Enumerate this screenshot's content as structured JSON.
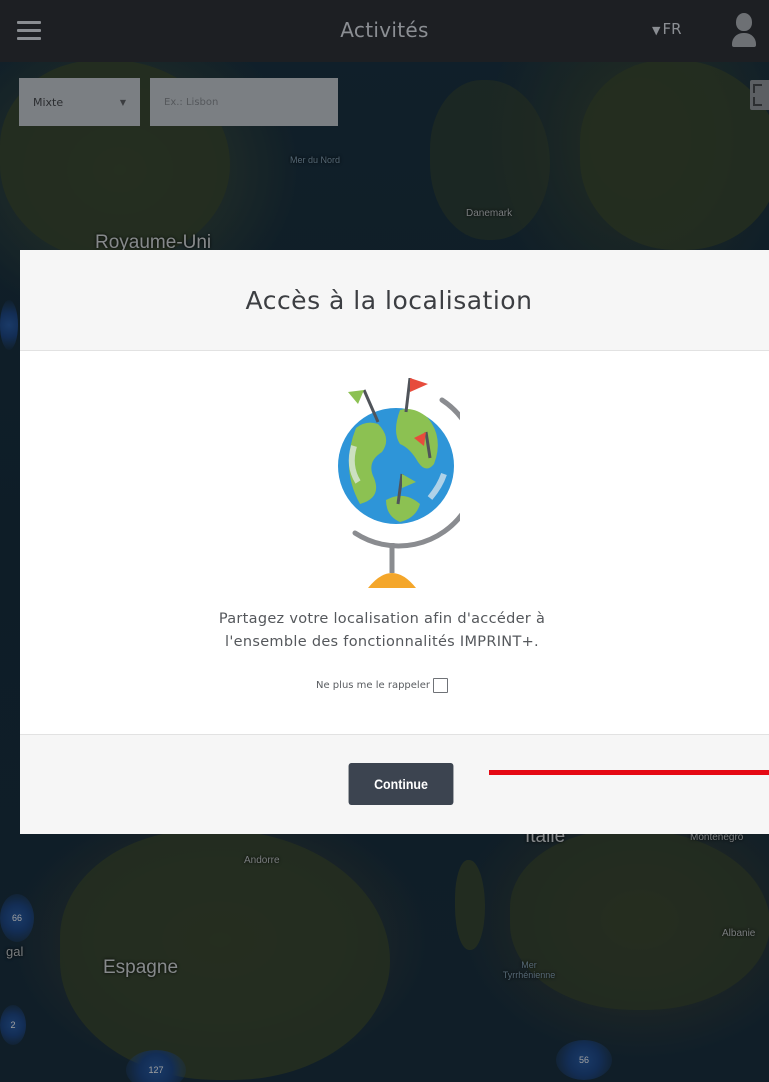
{
  "header": {
    "title": "Activités",
    "language": "FR",
    "language_caret": "▼"
  },
  "map_controls": {
    "mode_value": "Mixte",
    "mode_arrow": "▼",
    "search_placeholder": "Ex.: Lisbon"
  },
  "map": {
    "labels": {
      "royaume_uni": "Royaume-Uni",
      "mer_du_nord": "Mer du Nord",
      "danemark": "Danemark",
      "andorre": "Andorre",
      "italie": "Italie",
      "montenegro": "Montenegro",
      "albanie": "Albanie",
      "mer_tyrrhenienne": "Mer Tyrrhénienne",
      "espagne": "Espagne",
      "portugal_partial": "gal"
    },
    "clusters": {
      "c1": "66",
      "c2": "127",
      "c3": "56",
      "c4": "2"
    }
  },
  "modal": {
    "title": "Accès à la localisation",
    "message_line1": "Partagez votre localisation afin d'accéder à",
    "message_line2": "l'ensemble des fonctionnalités IMPRINT+.",
    "remember_label": "Ne plus me le rappeler",
    "continue_label": "Continue"
  },
  "colors": {
    "topbar": "#1d1f23",
    "button": "#3c4450",
    "annotation_line": "#e50914"
  }
}
